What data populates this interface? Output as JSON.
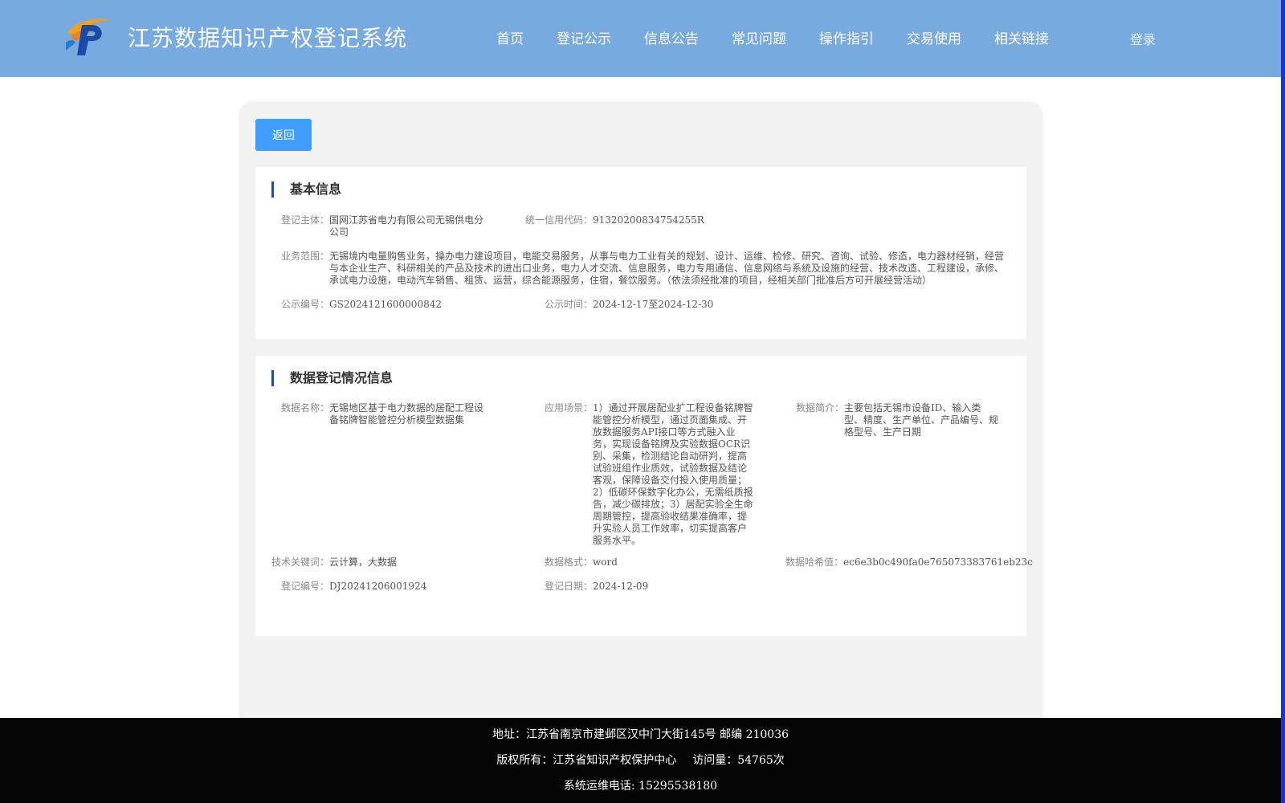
{
  "header": {
    "title": "江苏数据知识产权登记系统",
    "nav": [
      "首页",
      "登记公示",
      "信息公告",
      "常见问题",
      "操作指引",
      "交易使用",
      "相关链接"
    ],
    "login": "登录"
  },
  "back_label": "返回",
  "basic": {
    "section_title": "基本信息",
    "subject_label": "登记主体：",
    "subject": "国网江苏省电力有限公司无锡供电分公司",
    "credit_label": "统一信用代码：",
    "credit": "91320200834754255R",
    "scope_label": "业务范围：",
    "scope": "无锡境内电量购售业务，操办电力建设项目，电能交易服务，从事与电力工业有关的规划、设计、运维、检修、研究、咨询、试验、修造，电力器材经销，经营与本企业生产、科研相关的产品及技术的进出口业务，电力人才交流、信息服务，电力专用通信、信息网络与系统及设施的经营、技术改造、工程建设，承修、承试电力设施，电动汽车销售、租赁、运营，综合能源服务，住宿，餐饮服务。（依法须经批准的项目，经相关部门批准后方可开展经营活动）",
    "notice_no_label": "公示编号：",
    "notice_no": "GS2024121600000842",
    "notice_time_label": "公示时间：",
    "notice_time": "2024-12-17至2024-12-30"
  },
  "data_info": {
    "section_title": "数据登记情况信息",
    "name_label": "数据名称：",
    "name": "无锡地区基于电力数据的居配工程设备铭牌智能管控分析模型数据集",
    "scene_label": "应用场景：",
    "scene": "1）通过开展居配业扩工程设备铭牌智能管控分析模型，通过页面集成、开放数据服务API接口等方式融入业务，实现设备铭牌及实验数据OCR识别、采集，检测结论自动研判，提高试验班组作业质效，试验数据及结论客观，保障设备交付投入使用质量；2）低碳环保数字化办公，无需纸质报告，减少碳排放；3）居配实验全生命周期管控，提高验收结果准确率，提升实验人员工作效率，切实提高客户服务水平。",
    "intro_label": "数据简介：",
    "intro": "主要包括无锡市设备ID、输入类型、精度、生产单位、产品编号、规格型号、生产日期",
    "keywords_label": "技术关键词：",
    "keywords": "云计算，大数据",
    "format_label": "数据格式：",
    "format": "word",
    "hash_label": "数据哈希值：",
    "hash": "ec6e3b0c490fa0e765073383761eb23c",
    "reg_no_label": "登记编号：",
    "reg_no": "DJ20241206001924",
    "reg_date_label": "登记日期：",
    "reg_date": "2024-12-09"
  },
  "footer": {
    "address": "地址：江苏省南京市建邺区汉中门大街145号 邮编 210036",
    "copyright": "版权所有：江苏省知识产权保护中心",
    "visits": "访问量：54765次",
    "phone": "系统运维电话: 15295538180"
  }
}
